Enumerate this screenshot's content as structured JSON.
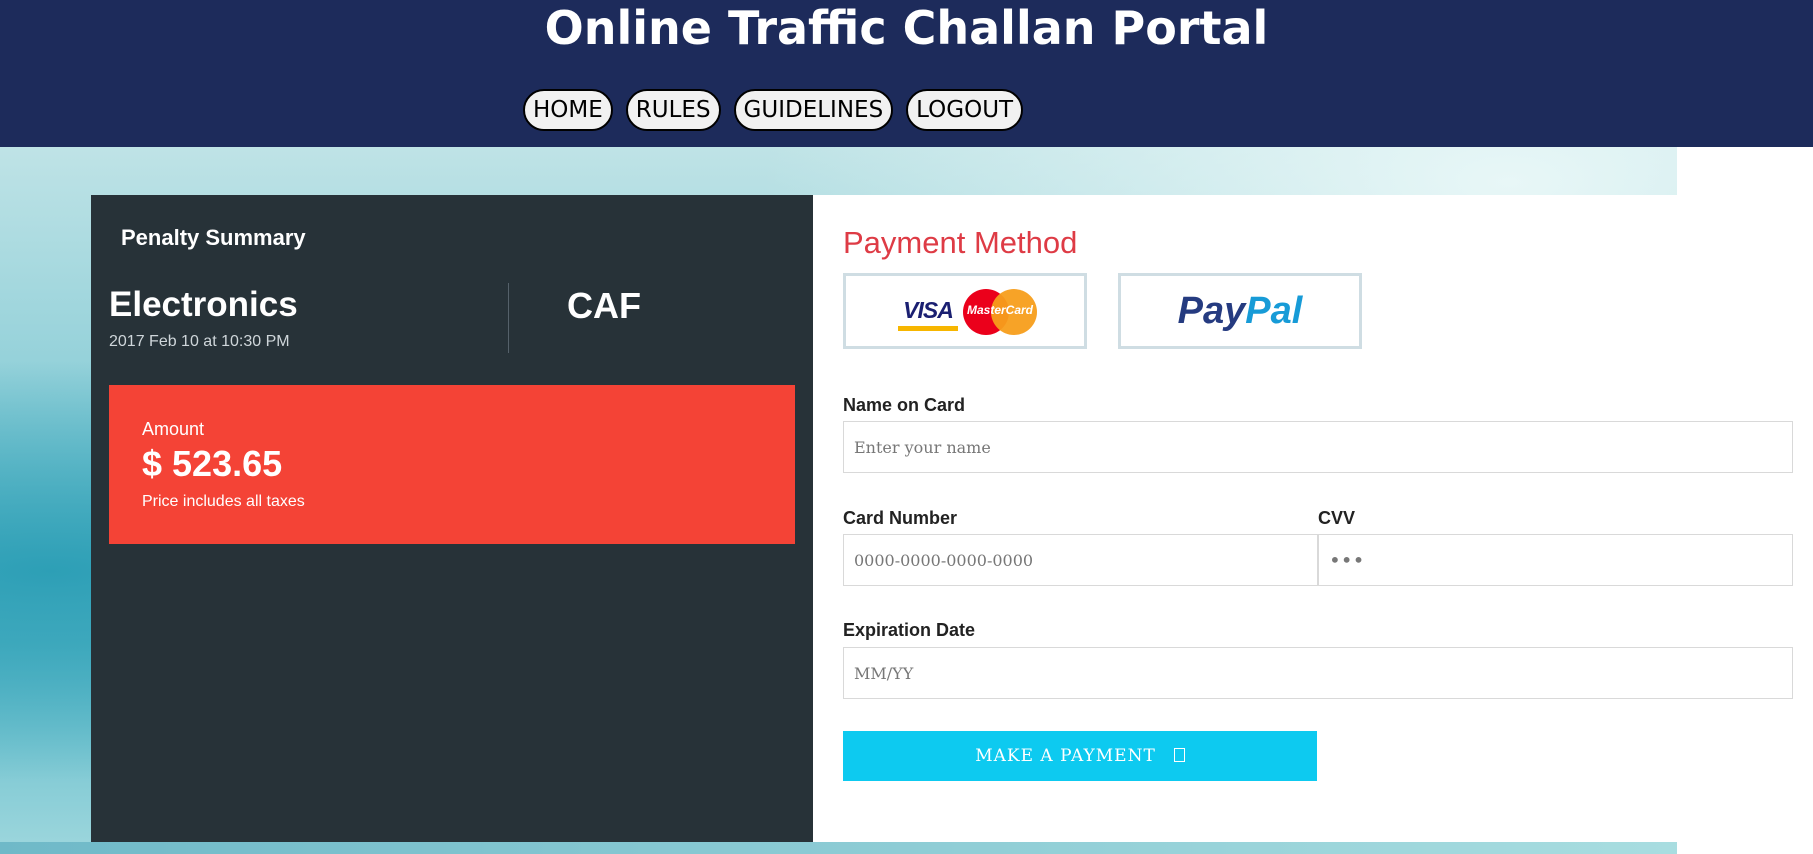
{
  "header": {
    "title": "Online Traffic Challan Portal",
    "nav": [
      "HOME",
      "RULES",
      "GUIDELINES",
      "LOGOUT"
    ]
  },
  "summary": {
    "title": "Penalty Summary",
    "product_name": "Electronics",
    "date": "2017 Feb 10 at 10:30 PM",
    "code": "CAF",
    "amount_label": "Amount",
    "amount_value": "$ 523.65",
    "amount_note": "Price includes all taxes"
  },
  "payment": {
    "title": "Payment Method",
    "card_brands": {
      "visa": "VISA",
      "mastercard": "MasterCard"
    },
    "paypal": {
      "part1": "Pay",
      "part2": "Pal"
    },
    "name_label": "Name on Card",
    "name_placeholder": "Enter your name",
    "card_label": "Card Number",
    "card_placeholder": "0000-0000-0000-0000",
    "cvv_label": "CVV",
    "cvv_placeholder": "•••",
    "exp_label": "Expiration Date",
    "exp_placeholder": "MM/YY",
    "button_label": "MAKE A PAYMENT"
  },
  "colors": {
    "header_bg": "#1d2b5b",
    "summary_bg": "#273238",
    "amount_bg": "#f44336",
    "title_accent": "#de3b45",
    "button_bg": "#0dcaf0"
  }
}
